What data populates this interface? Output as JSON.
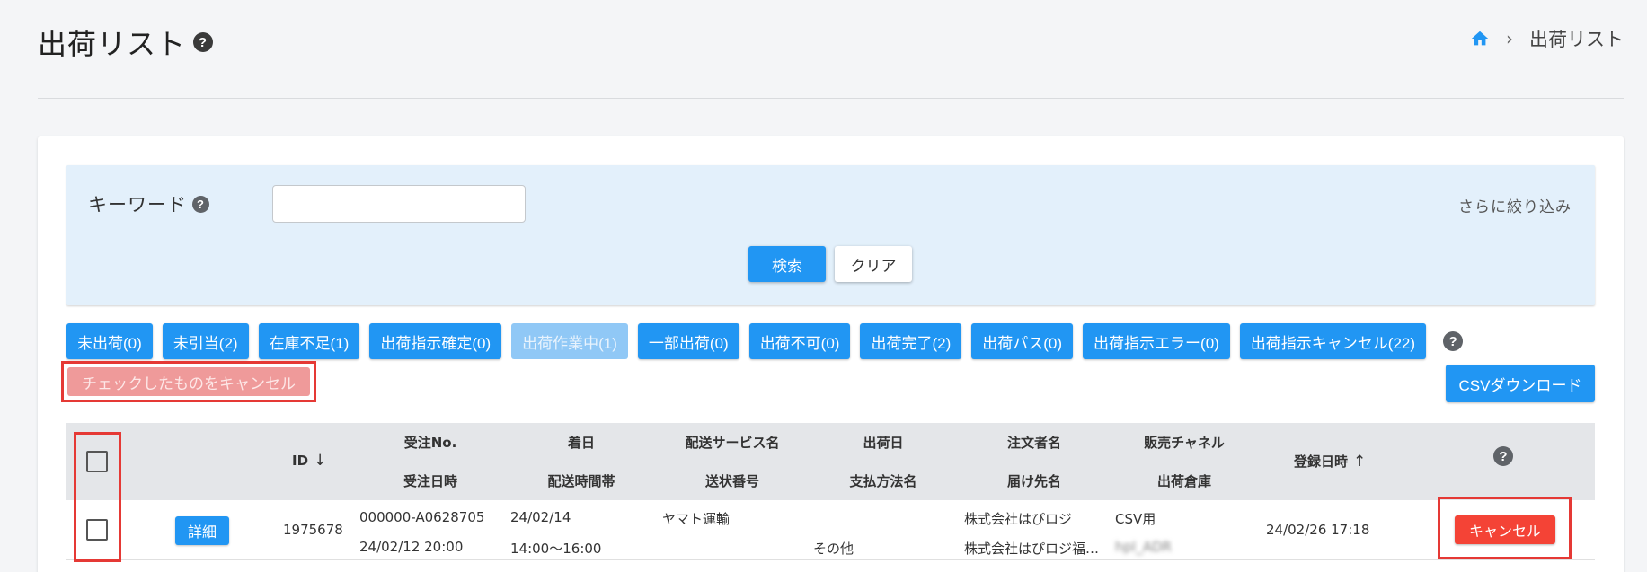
{
  "header": {
    "title": "出荷リスト",
    "breadcrumb": {
      "current": "出荷リスト"
    }
  },
  "search": {
    "label": "キーワード",
    "placeholder": "",
    "value": "",
    "narrow_label": "さらに絞り込み",
    "search_label": "検索",
    "clear_label": "クリア"
  },
  "filters": [
    {
      "label": "未出荷(0)",
      "disabled": false
    },
    {
      "label": "未引当(2)",
      "disabled": false
    },
    {
      "label": "在庫不足(1)",
      "disabled": false
    },
    {
      "label": "出荷指示確定(0)",
      "disabled": false
    },
    {
      "label": "出荷作業中(1)",
      "disabled": true
    },
    {
      "label": "一部出荷(0)",
      "disabled": false
    },
    {
      "label": "出荷不可(0)",
      "disabled": false
    },
    {
      "label": "出荷完了(2)",
      "disabled": false
    },
    {
      "label": "出荷パス(0)",
      "disabled": false
    },
    {
      "label": "出荷指示エラー(0)",
      "disabled": false
    },
    {
      "label": "出荷指示キャンセル(22)",
      "disabled": false
    }
  ],
  "actions": {
    "cancel_checked_label": "チェックしたものをキャンセル",
    "csv_label": "CSVダウンロード"
  },
  "table": {
    "headers": {
      "id": "ID",
      "order_no": "受注No.",
      "order_date": "受注日時",
      "arrival_date": "着日",
      "delivery_time": "配送時間帯",
      "delivery_service": "配送サービス名",
      "tracking_no": "送状番号",
      "ship_date": "出荷日",
      "payment": "支払方法名",
      "orderer": "注文者名",
      "recipient": "届け先名",
      "channel": "販売チャネル",
      "warehouse": "出荷倉庫",
      "registered": "登録日時"
    },
    "rows": [
      {
        "detail_label": "詳細",
        "id": "1975678",
        "order_no": "000000-A0628705",
        "order_date": "24/02/12 20:00",
        "arrival_date": "24/02/14",
        "delivery_time": "14:00〜16:00",
        "delivery_service": "ヤマト運輸",
        "tracking_no": "",
        "ship_date": "",
        "payment": "その他",
        "orderer": "株式会社はぴロジ",
        "recipient": "株式会社はぴロジ福…",
        "channel": "CSV用",
        "warehouse": "hpl_ADR",
        "registered": "24/02/26 17:18",
        "cancel_label": "キャンセル"
      }
    ]
  },
  "colors": {
    "primary": "#2196f3",
    "danger": "#f44336",
    "highlight": "#e53935",
    "panel": "#e3f0fb"
  }
}
